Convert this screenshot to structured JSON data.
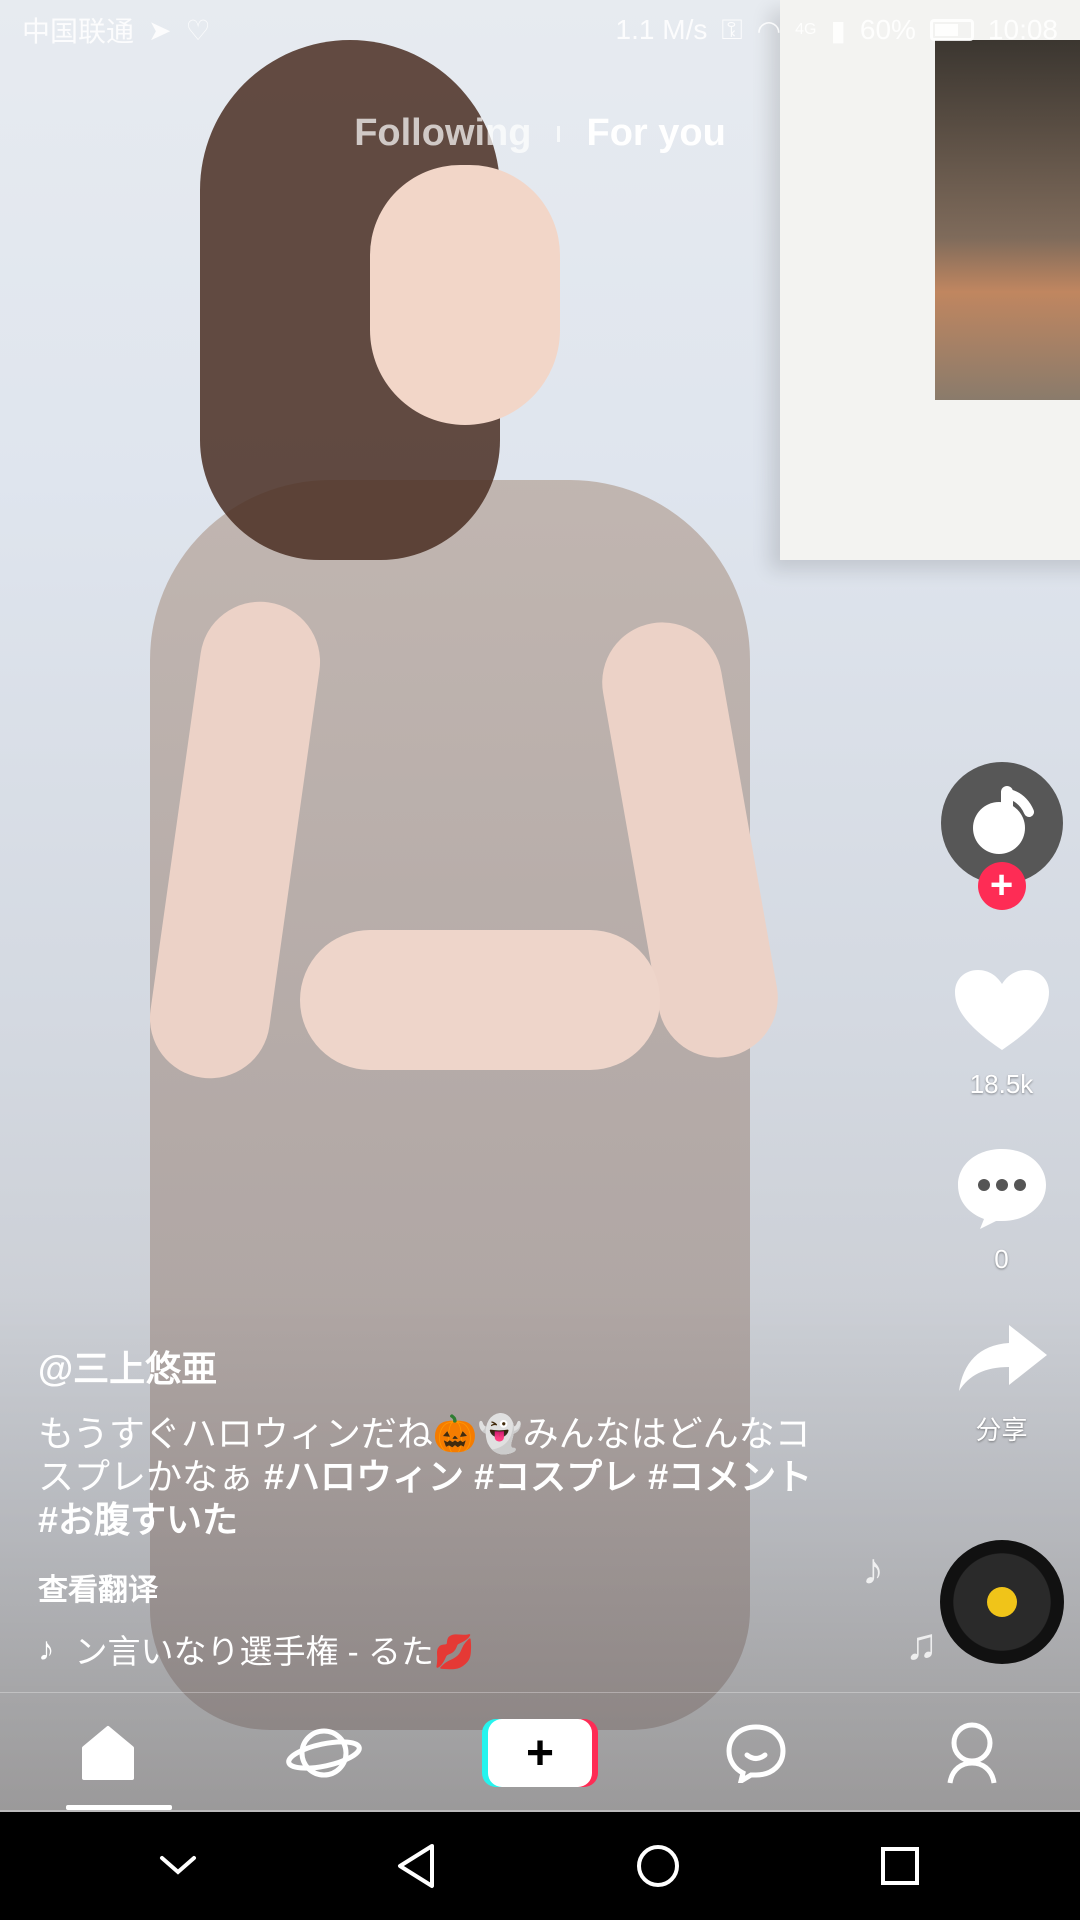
{
  "status_bar": {
    "carrier": "中国联通",
    "speed": "1.1 M/s",
    "network": "4G",
    "battery": "60%",
    "time": "10:08"
  },
  "top_tabs": [
    {
      "label": "Following"
    },
    {
      "label": "For you"
    }
  ],
  "actions": {
    "like_count": "18.5k",
    "comment_count": "0",
    "share_label": "分享"
  },
  "post": {
    "username": "@三上悠亜",
    "description_text": "もうすぐハロウィンだね🎃👻みんなはどんなコスプレかなぁ ",
    "hashtags": [
      "#ハロウィン",
      "#コスプレ",
      "#コメント",
      "#お腹すいた"
    ],
    "translate_label": "查看翻译",
    "music": "ン言いなり選手権 - るた💋"
  },
  "nav": {
    "items": [
      "home-icon",
      "discover-icon",
      "create-icon",
      "inbox-icon",
      "profile-icon"
    ],
    "create_label": "+"
  },
  "colors": {
    "accent": "#fe2c55",
    "cyan": "#25f4ee",
    "disc_center": "#f0c419"
  }
}
